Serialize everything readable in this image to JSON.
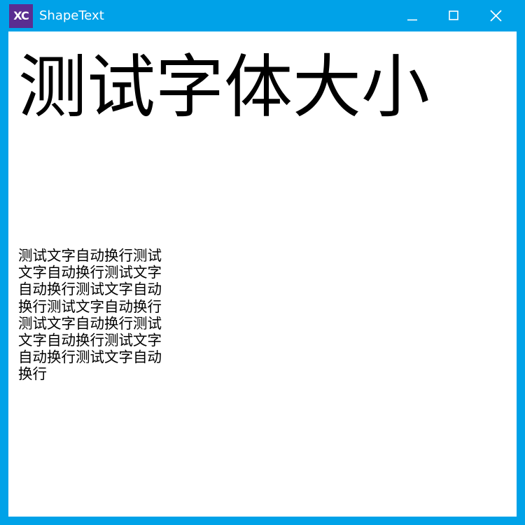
{
  "window": {
    "icon_text": "XC",
    "title": "ShapeText",
    "frame_color": "#00a2e8",
    "icon_color": "#5a2d91",
    "controls": {
      "minimize": "minimize-icon",
      "maximize": "maximize-icon",
      "close": "close-icon"
    }
  },
  "content": {
    "big_text": "测试字体大小",
    "wrap_text": "测试文字自动换行测试文字自动换行测试文字自动换行测试文字自动换行测试文字自动换行测试文字自动换行测试文字自动换行测试文字自动换行测试文字自动换行"
  }
}
